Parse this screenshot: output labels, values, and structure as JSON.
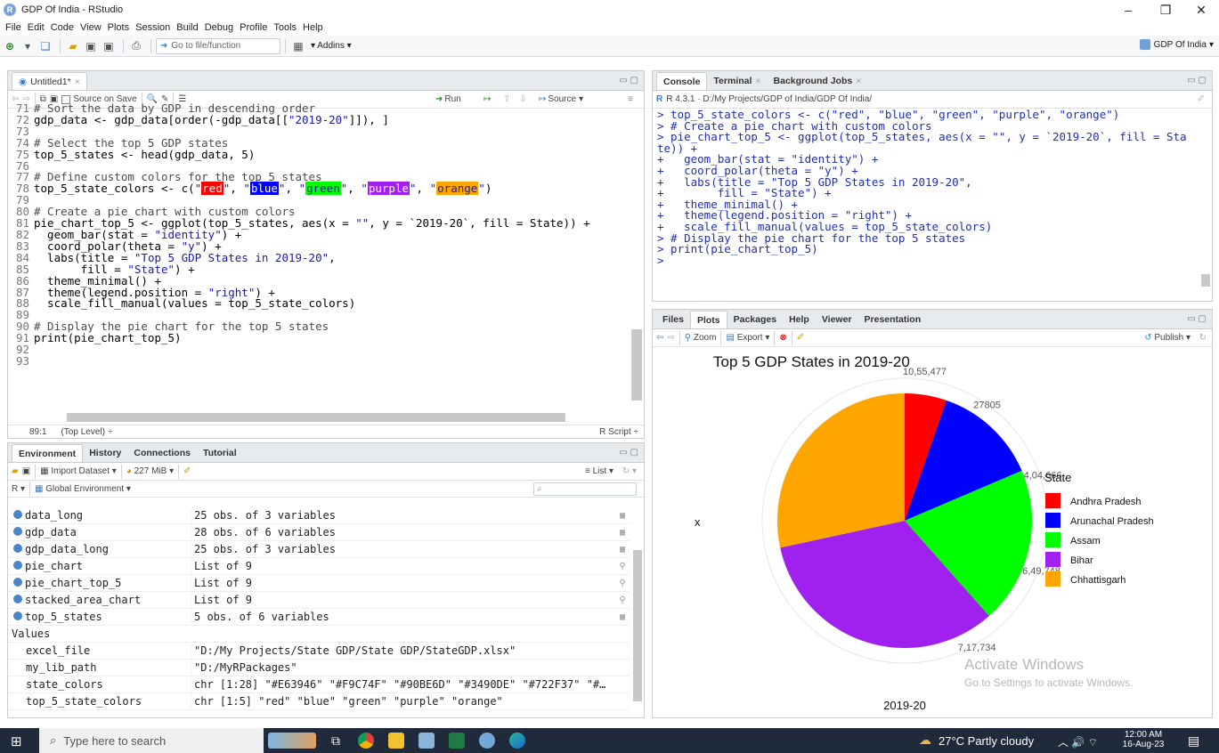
{
  "window": {
    "title": "GDP Of India - RStudio",
    "minimize": "–",
    "maximize": "❐",
    "close": "✕"
  },
  "menu": [
    "File",
    "Edit",
    "Code",
    "View",
    "Plots",
    "Session",
    "Build",
    "Debug",
    "Profile",
    "Tools",
    "Help"
  ],
  "toolbar": {
    "goto_placeholder": "Go to file/function",
    "addins": "Addins",
    "project": "GDP Of India"
  },
  "editor": {
    "tab": "Untitled1*",
    "source_on_save": "Source on Save",
    "run": "Run",
    "source": "Source",
    "status_pos": "89:1",
    "status_level": "(Top Level)",
    "status_type": "R Script",
    "line_numbers": [
      "71",
      "72",
      "73",
      "74",
      "75",
      "76",
      "77",
      "78",
      "79",
      "80",
      "81",
      "82",
      "83",
      "84",
      "85",
      "86",
      "87",
      "88",
      "89",
      "90",
      "91",
      "92",
      "93"
    ],
    "lines": [
      {
        "c": "# Sort the data by GDP in descending order"
      },
      {
        "t": "gdp_data <- gdp_data[order(-gdp_data[[",
        "s": "\"2019-20\"",
        "t2": "]]), ]"
      },
      {
        "t": ""
      },
      {
        "c": "# Select the top 5 GDP states"
      },
      {
        "t": "top_5_states <- head(gdp_data, 5)"
      },
      {
        "t": ""
      },
      {
        "c": "# Define custom colors for the top 5 states"
      },
      {
        "t": ""
      },
      {
        "t": ""
      },
      {
        "c": "# Create a pie chart with custom colors"
      },
      {
        "t": "pie_chart_top_5 <- ggplot(top_5_states, aes(x = ",
        "s": "\"\"",
        "t2": ", y = `2019-20`, fill = State)) +"
      },
      {
        "t": "  geom_bar(stat = ",
        "s": "\"identity\"",
        "t2": ") +"
      },
      {
        "t": "  coord_polar(theta = ",
        "s": "\"y\"",
        "t2": ") +"
      },
      {
        "t": "  labs(title = ",
        "s": "\"Top 5 GDP States in 2019-20\"",
        "t2": ","
      },
      {
        "t": "       fill = ",
        "s": "\"State\"",
        "t2": ") +"
      },
      {
        "t": "  theme_minimal() +"
      },
      {
        "t": "  theme(legend.position = ",
        "s": "\"right\"",
        "t2": ") +"
      },
      {
        "t": "  scale_fill_manual(values = top_5_state_colors)"
      },
      {
        "t": ""
      },
      {
        "c": "# Display the pie chart for the top 5 states"
      },
      {
        "t": "print(pie_chart_top_5)"
      },
      {
        "t": ""
      },
      {
        "t": ""
      }
    ],
    "colors_line": {
      "pre": "top_5_state_colors <- c(",
      "sep": ", ",
      "post": ")",
      "swatches": [
        {
          "label": "red",
          "bg": "#ff0000",
          "fg": "#ffffff"
        },
        {
          "label": "blue",
          "bg": "#0000ff",
          "fg": "#ffffff"
        },
        {
          "label": "green",
          "bg": "#00ff00",
          "fg": "#1a1aa6"
        },
        {
          "label": "purple",
          "bg": "#a020f0",
          "fg": "#ffffff"
        },
        {
          "label": "orange",
          "bg": "#ffa500",
          "fg": "#1a1aa6"
        }
      ]
    }
  },
  "env": {
    "tabs": [
      "Environment",
      "History",
      "Connections",
      "Tutorial"
    ],
    "import": "Import Dataset",
    "memory": "227 MiB",
    "list": "List",
    "r": "R",
    "global": "Global Environment",
    "values_header": "Values",
    "rows": [
      {
        "name": "data_long",
        "value": "25 obs. of 3 variables"
      },
      {
        "name": "gdp_data",
        "value": "28 obs. of 6 variables"
      },
      {
        "name": "gdp_data_long",
        "value": "25 obs. of 3 variables"
      },
      {
        "name": "pie_chart",
        "value": "List of  9"
      },
      {
        "name": "pie_chart_top_5",
        "value": "List of  9"
      },
      {
        "name": "stacked_area_chart",
        "value": "List of  9"
      },
      {
        "name": "top_5_states",
        "value": "5 obs. of 6 variables"
      }
    ],
    "values": [
      {
        "name": "excel_file",
        "value": "\"D:/My Projects/State GDP/State GDP/StateGDP.xlsx\""
      },
      {
        "name": "my_lib_path",
        "value": "\"D:/MyRPackages\""
      },
      {
        "name": "state_colors",
        "value": "chr [1:28] \"#E63946\" \"#F9C74F\" \"#90BE6D\" \"#3490DE\" \"#722F37\" \"#…"
      },
      {
        "name": "top_5_state_colors",
        "value": "chr [1:5] \"red\" \"blue\" \"green\" \"purple\" \"orange\""
      }
    ]
  },
  "console": {
    "tabs": [
      "Console",
      "Terminal",
      "Background Jobs"
    ],
    "path": "R 4.3.1 · D:/My Projects/GDP of India/GDP Of India/",
    "lines": [
      "> top_5_state_colors <- c(\"red\", \"blue\", \"green\", \"purple\", \"orange\")",
      "> # Create a pie chart with custom colors",
      "> pie_chart_top_5 <- ggplot(top_5_states, aes(x = \"\", y = `2019-20`, fill = Sta",
      "te)) +",
      "+   geom_bar(stat = \"identity\") +",
      "+   coord_polar(theta = \"y\") +",
      "+   labs(title = \"Top 5 GDP States in 2019-20\",",
      "+        fill = \"State\") +",
      "+   theme_minimal() +",
      "+   theme(legend.position = \"right\") +",
      "+   scale_fill_manual(values = top_5_state_colors)",
      "> # Display the pie chart for the top 5 states",
      "> print(pie_chart_top_5)",
      ">"
    ]
  },
  "plots": {
    "tabs": [
      "Files",
      "Plots",
      "Packages",
      "Help",
      "Viewer",
      "Presentation"
    ],
    "zoom": "Zoom",
    "export": "Export",
    "publish": "Publish"
  },
  "chart_data": {
    "type": "pie",
    "title": "Top 5 GDP States in 2019-20",
    "xlabel": "2019-20",
    "ylabel": "x",
    "legend_title": "State",
    "legend_position": "right",
    "categories": [
      "Andhra Pradesh",
      "Arunachal Pradesh",
      "Assam",
      "Bihar",
      "Chhattisgarh"
    ],
    "colors": [
      "#ff0000",
      "#0000ff",
      "#00ff00",
      "#a020f0",
      "#ffa500"
    ],
    "values": [
      56200,
      140000,
      210000,
      350000,
      300000
    ],
    "axis_tick_labels": [
      "10,55,477",
      "27805",
      "4,04,666",
      "6,49,748",
      "7,17,734"
    ]
  },
  "watermark": {
    "line1": "Activate Windows",
    "line2": "Go to Settings to activate Windows."
  },
  "taskbar": {
    "search": "Type here to search",
    "weather": "27°C  Partly cloudy",
    "time": "12:00 AM",
    "date": "16-Aug-23"
  }
}
